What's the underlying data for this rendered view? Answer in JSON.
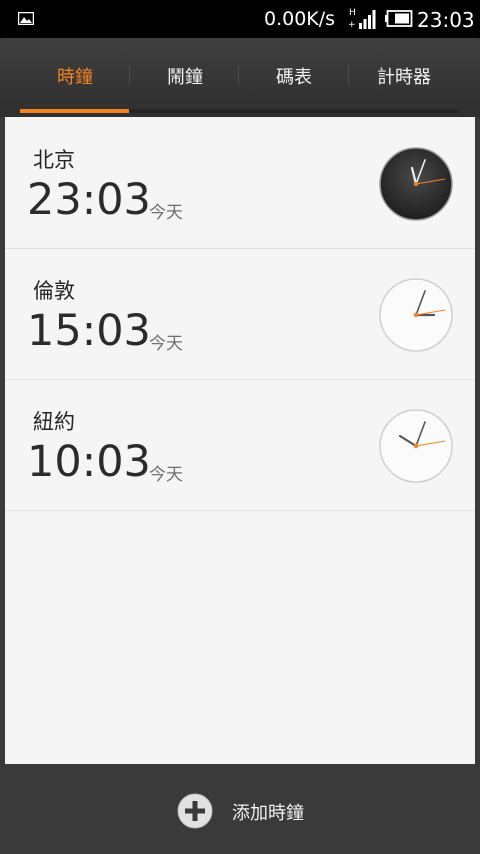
{
  "status_bar": {
    "image_icon": "image-notification-icon",
    "net_speed": "0.00K/s",
    "network_icon": "hplus-signal-icon",
    "battery_icon": "battery-icon",
    "time": "23:03"
  },
  "tabs": [
    {
      "label": "時鐘",
      "active": true
    },
    {
      "label": "鬧鐘",
      "active": false
    },
    {
      "label": "碼表",
      "active": false
    },
    {
      "label": "計時器",
      "active": false
    }
  ],
  "accent_color": "#f6821f",
  "clocks": [
    {
      "city": "北京",
      "time": "23:03",
      "day": "今天",
      "dial_theme": "dark"
    },
    {
      "city": "倫敦",
      "time": "15:03",
      "day": "今天",
      "dial_theme": "light"
    },
    {
      "city": "紐約",
      "time": "10:03",
      "day": "今天",
      "dial_theme": "light"
    }
  ],
  "bottom_bar": {
    "add_label": "添加時鐘",
    "add_icon": "plus-circle-icon"
  }
}
